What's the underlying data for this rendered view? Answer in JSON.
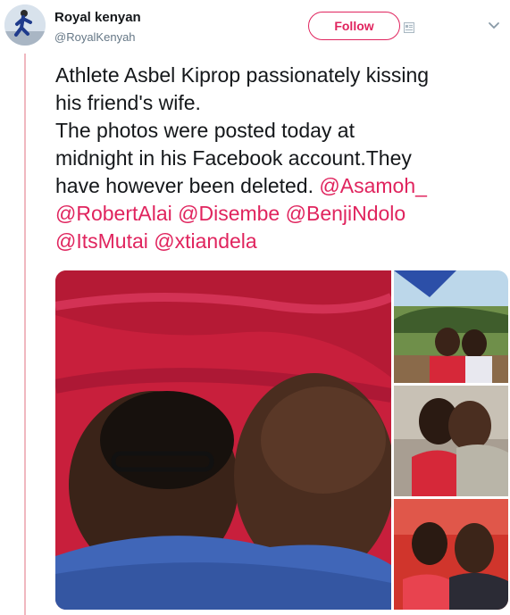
{
  "user": {
    "name": "Royal kenyan",
    "handle": "@RoyalKenyah",
    "avatar_icon": "runner-avatar-icon"
  },
  "actions": {
    "follow_label": "Follow",
    "menu_icon": "chevron-down-icon",
    "follow_icon": "user-card-icon"
  },
  "tweet": {
    "line1": "Athlete Asbel Kiprop passionately kissing",
    "line2": "his friend's wife.",
    "line3": "The photos were posted today at",
    "line4": "midnight in his Facebook account.They",
    "line5_text": "have however been deleted. ",
    "mentions": [
      "@Asamoh_",
      "@RobertAlai",
      "@Disembe",
      "@BenjiNdolo",
      "@ItsMutai",
      "@xtiandela"
    ]
  },
  "media": {
    "photos": [
      "main-photo",
      "photo-top-right",
      "photo-middle-right",
      "photo-bottom-right"
    ]
  },
  "colors": {
    "accent": "#e0245e",
    "thread_line": "#f0b8bf",
    "text": "#14171a",
    "muted": "#657786"
  }
}
